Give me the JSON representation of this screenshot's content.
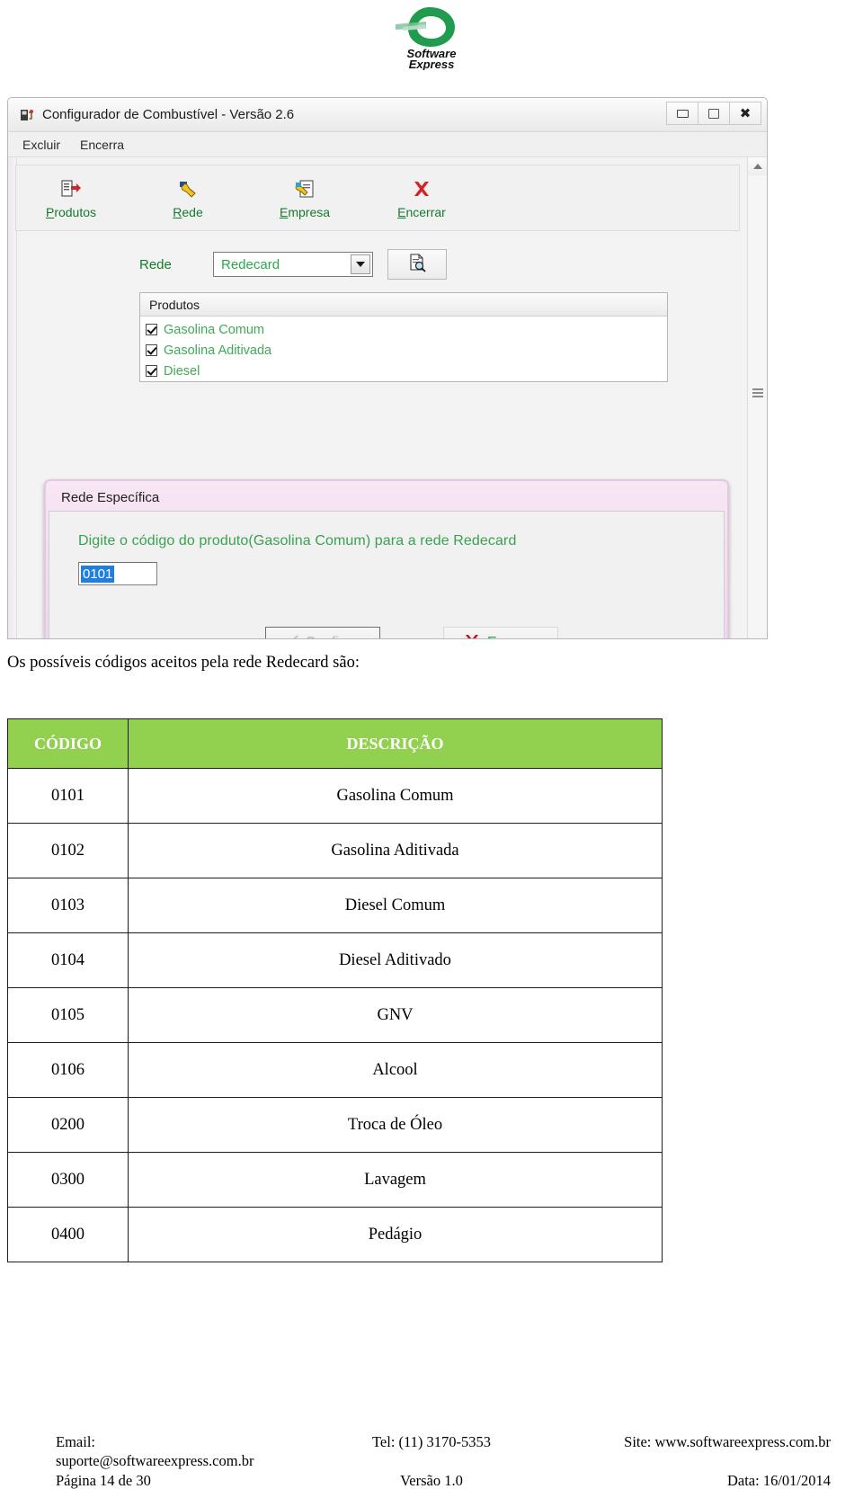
{
  "brand": {
    "name_line1": "Software",
    "name_line2": "Express",
    "logo_color": "#1f9c4d"
  },
  "screenshot": {
    "window": {
      "title": "Configurador de Combustível  -  Versão 2.6",
      "icon": "fuel-pump-icon",
      "buttons": {
        "minimize": "minimize-icon",
        "maximize": "maximize-icon",
        "close": "close-icon"
      }
    },
    "menubar": {
      "items": [
        {
          "label": "Excluir"
        },
        {
          "label": "Encerra"
        }
      ]
    },
    "toolbar": {
      "items": [
        {
          "label_pre": "",
          "label_accel": "P",
          "label_post": "rodutos",
          "icon": "produtos-icon"
        },
        {
          "label_pre": "",
          "label_accel": "R",
          "label_post": "ede",
          "icon": "rede-icon"
        },
        {
          "label_pre": "",
          "label_accel": "E",
          "label_post": "mpresa",
          "icon": "empresa-icon"
        },
        {
          "label_pre": "",
          "label_accel": "E",
          "label_post": "ncerrar",
          "icon": "encerrar-icon"
        }
      ]
    },
    "rede_field": {
      "label": "Rede",
      "selected_value": "Redecard",
      "preview_icon": "document-search-icon"
    },
    "produtos_group": {
      "header": "Produtos",
      "items": [
        {
          "label": "Gasolina Comum",
          "checked": true
        },
        {
          "label": "Gasolina Aditivada",
          "checked": true
        },
        {
          "label": "Diesel",
          "checked": true
        }
      ]
    },
    "dialog": {
      "title": "Rede Específica",
      "prompt": "Digite o código do produto(Gasolina Comum) para a rede Redecard",
      "input_value": "0101",
      "confirm_button": {
        "accel": "C",
        "rest": "onfirma",
        "icon": "check-icon",
        "disabled": true
      },
      "cancel_button": {
        "accel": "E",
        "rest": "ncerra",
        "icon": "red-x-icon",
        "disabled": false
      }
    }
  },
  "document": {
    "intro": "Os possíveis códigos aceitos pela rede Redecard são:",
    "table": {
      "accent_color": "#92d14f",
      "headers": [
        "CÓDIGO",
        "DESCRIÇÃO"
      ],
      "rows": [
        {
          "codigo": "0101",
          "descricao": "Gasolina Comum"
        },
        {
          "codigo": "0102",
          "descricao": "Gasolina Aditivada"
        },
        {
          "codigo": "0103",
          "descricao": "Diesel Comum"
        },
        {
          "codigo": "0104",
          "descricao": "Diesel Aditivado"
        },
        {
          "codigo": "0105",
          "descricao": "GNV"
        },
        {
          "codigo": "0106",
          "descricao": "Alcool"
        },
        {
          "codigo": "0200",
          "descricao": "Troca de Óleo"
        },
        {
          "codigo": "0300",
          "descricao": "Lavagem"
        },
        {
          "codigo": "0400",
          "descricao": "Pedágio"
        }
      ]
    }
  },
  "footer": {
    "email": "Email: suporte@softwareexpress.com.br",
    "tel": "Tel: (11) 3170-5353",
    "site": "Site: www.softwareexpress.com.br",
    "page": "Página 14 de 30",
    "version": "Versão 1.0",
    "date": "Data: 16/01/2014"
  }
}
